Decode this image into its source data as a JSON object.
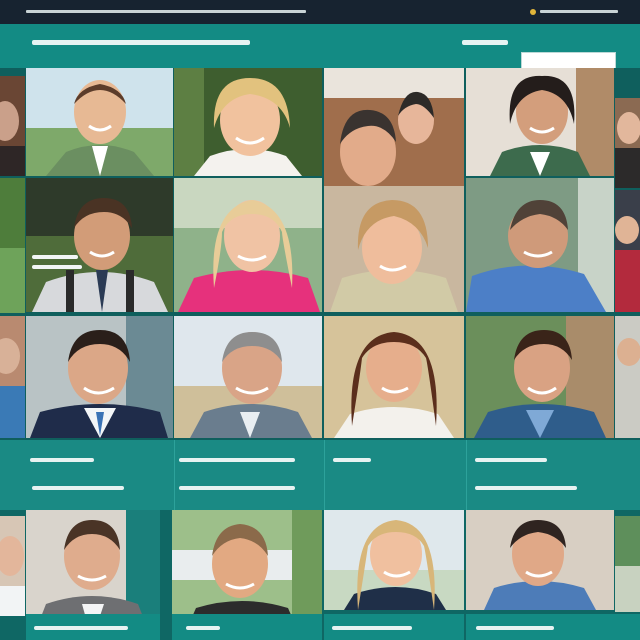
{
  "colors": {
    "topbar": "#172330",
    "teal": "#138b84",
    "teal_dark": "#0f5f5d",
    "accent": "#e0b53a"
  },
  "search": {
    "placeholder": ""
  },
  "icons": [
    "badge-icon"
  ]
}
